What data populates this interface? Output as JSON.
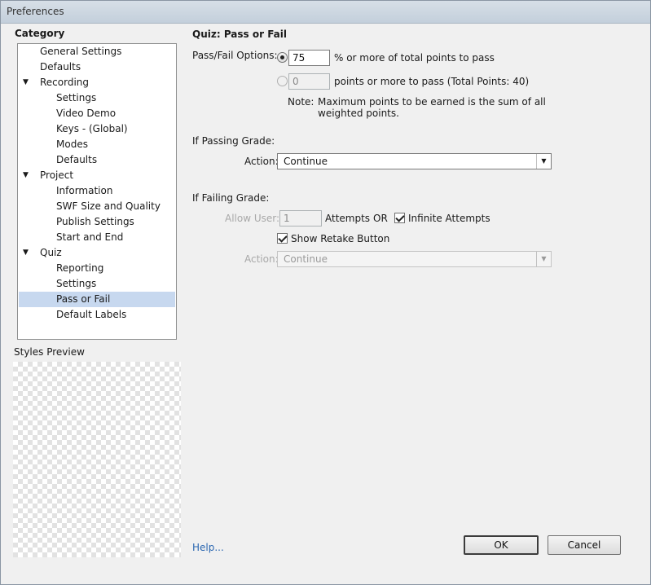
{
  "window": {
    "title": "Preferences"
  },
  "category": {
    "heading": "Category",
    "items": [
      {
        "label": "General Settings",
        "level": 0,
        "arrow": false,
        "selected": false
      },
      {
        "label": "Defaults",
        "level": 0,
        "arrow": false,
        "selected": false
      },
      {
        "label": "Recording",
        "level": 0,
        "arrow": true,
        "selected": false
      },
      {
        "label": "Settings",
        "level": 1,
        "arrow": false,
        "selected": false
      },
      {
        "label": "Video Demo",
        "level": 1,
        "arrow": false,
        "selected": false
      },
      {
        "label": "Keys - (Global)",
        "level": 1,
        "arrow": false,
        "selected": false
      },
      {
        "label": "Modes",
        "level": 1,
        "arrow": false,
        "selected": false
      },
      {
        "label": "Defaults",
        "level": 1,
        "arrow": false,
        "selected": false
      },
      {
        "label": "Project",
        "level": 0,
        "arrow": true,
        "selected": false
      },
      {
        "label": "Information",
        "level": 1,
        "arrow": false,
        "selected": false
      },
      {
        "label": "SWF Size and Quality",
        "level": 1,
        "arrow": false,
        "selected": false
      },
      {
        "label": "Publish Settings",
        "level": 1,
        "arrow": false,
        "selected": false
      },
      {
        "label": "Start and End",
        "level": 1,
        "arrow": false,
        "selected": false
      },
      {
        "label": "Quiz",
        "level": 0,
        "arrow": true,
        "selected": false
      },
      {
        "label": "Reporting",
        "level": 1,
        "arrow": false,
        "selected": false
      },
      {
        "label": "Settings",
        "level": 1,
        "arrow": false,
        "selected": false
      },
      {
        "label": "Pass or Fail",
        "level": 1,
        "arrow": false,
        "selected": true
      },
      {
        "label": "Default Labels",
        "level": 1,
        "arrow": false,
        "selected": false
      }
    ],
    "styles_preview_label": "Styles Preview"
  },
  "pass_fail": {
    "title": "Quiz: Pass or Fail",
    "options_label": "Pass/Fail Options:",
    "percent_value": "75",
    "percent_suffix": "% or more of total points to pass",
    "points_value": "0",
    "points_suffix": "points or more to pass (Total Points: 40)",
    "note_prefix": "Note:",
    "note_text_line1": "Maximum points to be earned is the sum of all",
    "note_text_line2": "weighted points."
  },
  "passing": {
    "label": "If Passing Grade:",
    "action_label": "Action:",
    "action_value": "Continue"
  },
  "failing": {
    "label": "If Failing Grade:",
    "allow_user_label": "Allow User:",
    "attempts_value": "1",
    "attempts_label": "Attempts",
    "or_label": "OR",
    "infinite_label": "Infinite Attempts",
    "infinite_checked": true,
    "show_retake_label": "Show Retake Button",
    "show_retake_checked": true,
    "action_label": "Action:",
    "action_value": "Continue"
  },
  "footer": {
    "help_label": "Help...",
    "ok_label": "OK",
    "cancel_label": "Cancel"
  },
  "icons": {
    "expand_arrow": "▼",
    "dropdown_arrow": "▼"
  }
}
